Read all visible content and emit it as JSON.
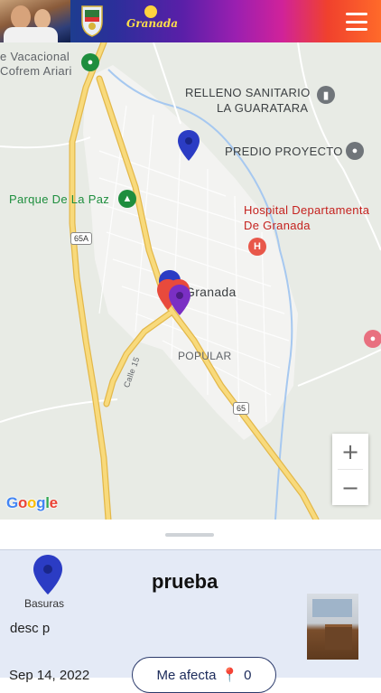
{
  "header": {
    "logo_text": "Granada",
    "menu_icon": "hamburger-menu-icon"
  },
  "map": {
    "labels": {
      "vacacional_line1": "e Vacacional",
      "vacacional_line2": "Cofrem Ariari",
      "relleno_line1": "RELLENO SANITARIO",
      "relleno_line2": "LA GUARATARA",
      "predio": "PREDIO PROYECTO",
      "parque": "Parque De La Paz",
      "hospital_line1": "Hospital Departamenta",
      "hospital_line2": "De Granada",
      "town": "Granada",
      "popular": "POPULAR",
      "calle": "Calle 15"
    },
    "road_badges": {
      "r65a": "65A",
      "r65": "65"
    },
    "zoom_in": "+",
    "zoom_out": "−",
    "attribution": "Google",
    "colors": {
      "pin_blue": "#2b3cc4",
      "pin_red": "#e84a3c",
      "pin_purple": "#7a2fc4",
      "road_yellow": "#f7d46a",
      "urban": "#f2f2f2"
    }
  },
  "report": {
    "category_icon": "map-pin-icon",
    "category": "Basuras",
    "title": "prueba",
    "description": "desc p",
    "date": "Sep 14, 2022",
    "affect_label": "Me afecta",
    "affect_icon": "pin-up-icon",
    "affect_count": "0"
  }
}
